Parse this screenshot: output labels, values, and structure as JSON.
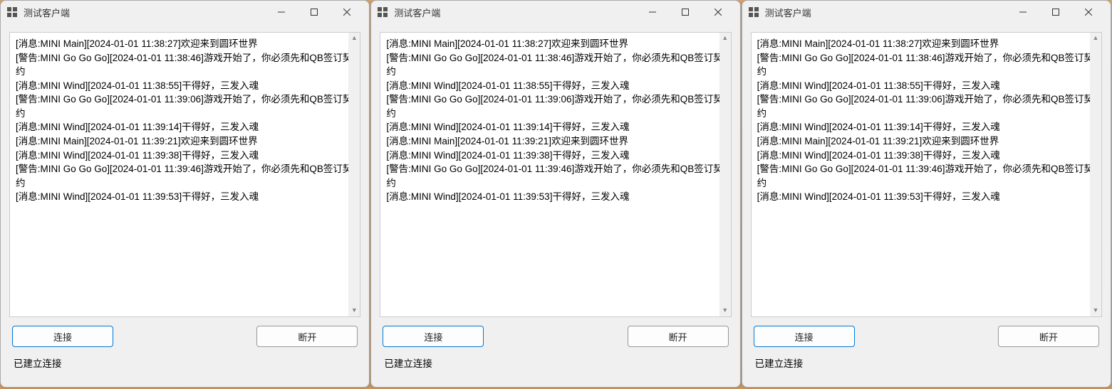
{
  "windows": [
    {
      "title": "测试客户端",
      "log_lines": [
        "[消息:MINI Main][2024-01-01 11:38:27]欢迎来到圆环世界",
        "[警告:MINI Go Go Go][2024-01-01 11:38:46]游戏开始了，你必须先和QB签订契约",
        "[消息:MINI Wind][2024-01-01 11:38:55]干得好，三发入魂",
        "[警告:MINI Go Go Go][2024-01-01 11:39:06]游戏开始了，你必须先和QB签订契约",
        "[消息:MINI Wind][2024-01-01 11:39:14]干得好，三发入魂",
        "[消息:MINI Main][2024-01-01 11:39:21]欢迎来到圆环世界",
        "[消息:MINI Wind][2024-01-01 11:39:38]干得好，三发入魂",
        "[警告:MINI Go Go Go][2024-01-01 11:39:46]游戏开始了，你必须先和QB签订契约",
        "[消息:MINI Wind][2024-01-01 11:39:53]干得好，三发入魂"
      ],
      "connect_label": "连接",
      "disconnect_label": "断开",
      "status": "已建立连接"
    },
    {
      "title": "测试客户端",
      "log_lines": [
        "[消息:MINI Main][2024-01-01 11:38:27]欢迎来到圆环世界",
        "[警告:MINI Go Go Go][2024-01-01 11:38:46]游戏开始了，你必须先和QB签订契约",
        "[消息:MINI Wind][2024-01-01 11:38:55]干得好，三发入魂",
        "[警告:MINI Go Go Go][2024-01-01 11:39:06]游戏开始了，你必须先和QB签订契约",
        "[消息:MINI Wind][2024-01-01 11:39:14]干得好，三发入魂",
        "[消息:MINI Main][2024-01-01 11:39:21]欢迎来到圆环世界",
        "[消息:MINI Wind][2024-01-01 11:39:38]干得好，三发入魂",
        "[警告:MINI Go Go Go][2024-01-01 11:39:46]游戏开始了，你必须先和QB签订契约",
        "[消息:MINI Wind][2024-01-01 11:39:53]干得好，三发入魂"
      ],
      "connect_label": "连接",
      "disconnect_label": "断开",
      "status": "已建立连接"
    },
    {
      "title": "测试客户端",
      "log_lines": [
        "[消息:MINI Main][2024-01-01 11:38:27]欢迎来到圆环世界",
        "[警告:MINI Go Go Go][2024-01-01 11:38:46]游戏开始了，你必须先和QB签订契约",
        "[消息:MINI Wind][2024-01-01 11:38:55]干得好，三发入魂",
        "[警告:MINI Go Go Go][2024-01-01 11:39:06]游戏开始了，你必须先和QB签订契约",
        "[消息:MINI Wind][2024-01-01 11:39:14]干得好，三发入魂",
        "[消息:MINI Main][2024-01-01 11:39:21]欢迎来到圆环世界",
        "[消息:MINI Wind][2024-01-01 11:39:38]干得好，三发入魂",
        "[警告:MINI Go Go Go][2024-01-01 11:39:46]游戏开始了，你必须先和QB签订契约",
        "[消息:MINI Wind][2024-01-01 11:39:53]干得好，三发入魂"
      ],
      "connect_label": "连接",
      "disconnect_label": "断开",
      "status": "已建立连接"
    }
  ]
}
